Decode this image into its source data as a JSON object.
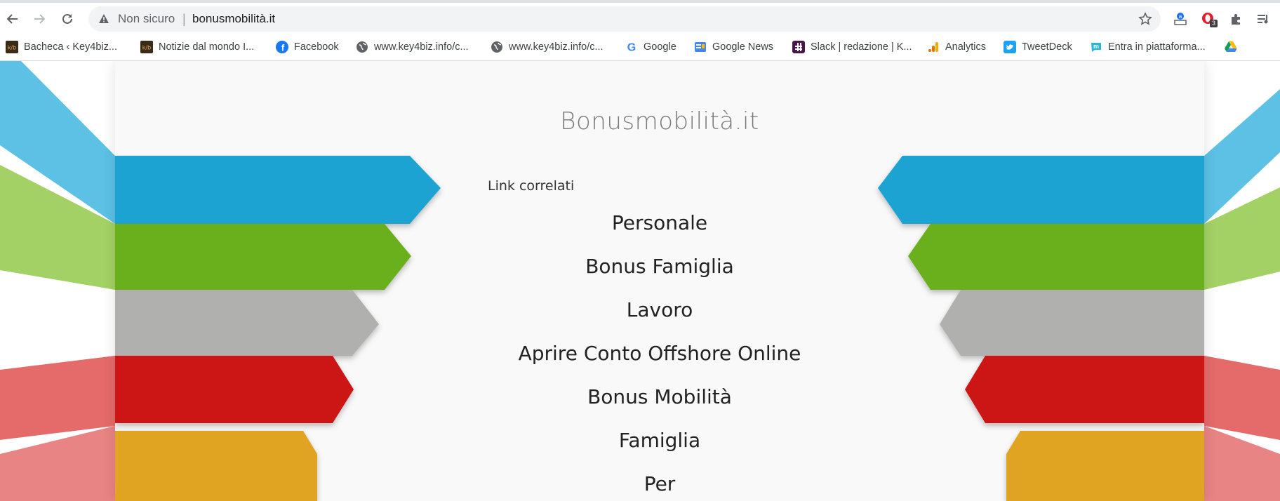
{
  "browser": {
    "not_secure_label": "Non sicuro",
    "separator": "|",
    "url": "bonusmobilità.it",
    "extension_badge": "3"
  },
  "bookmarks": [
    {
      "label": "Bacheca ‹ Key4biz...",
      "icon": "key4biz-icon"
    },
    {
      "label": "Notizie dal mondo I...",
      "icon": "key4biz-icon"
    },
    {
      "label": "Facebook",
      "icon": "facebook-icon"
    },
    {
      "label": "www.key4biz.info/c...",
      "icon": "globe-icon"
    },
    {
      "label": "www.key4biz.info/c...",
      "icon": "globe-icon"
    },
    {
      "label": "Google",
      "icon": "google-icon"
    },
    {
      "label": "Google News",
      "icon": "google-news-icon"
    },
    {
      "label": "Slack | redazione | K...",
      "icon": "slack-icon"
    },
    {
      "label": "Analytics",
      "icon": "analytics-icon"
    },
    {
      "label": "TweetDeck",
      "icon": "tweetdeck-icon"
    },
    {
      "label": "Entra in piattaforma...",
      "icon": "platform-icon"
    }
  ],
  "page": {
    "title": "Bonusmobilità.it",
    "related_label": "Link correlati",
    "links": [
      "Personale",
      "Bonus Famiglia",
      "Lavoro",
      "Aprire Conto Offshore Online",
      "Bonus Mobilità",
      "Famiglia",
      "Per"
    ]
  },
  "colors": {
    "blue": "#1aa3d1",
    "green": "#6aaf1e",
    "gray": "#b0b0ae",
    "red": "#cc1414",
    "yellow": "#e0a420"
  }
}
